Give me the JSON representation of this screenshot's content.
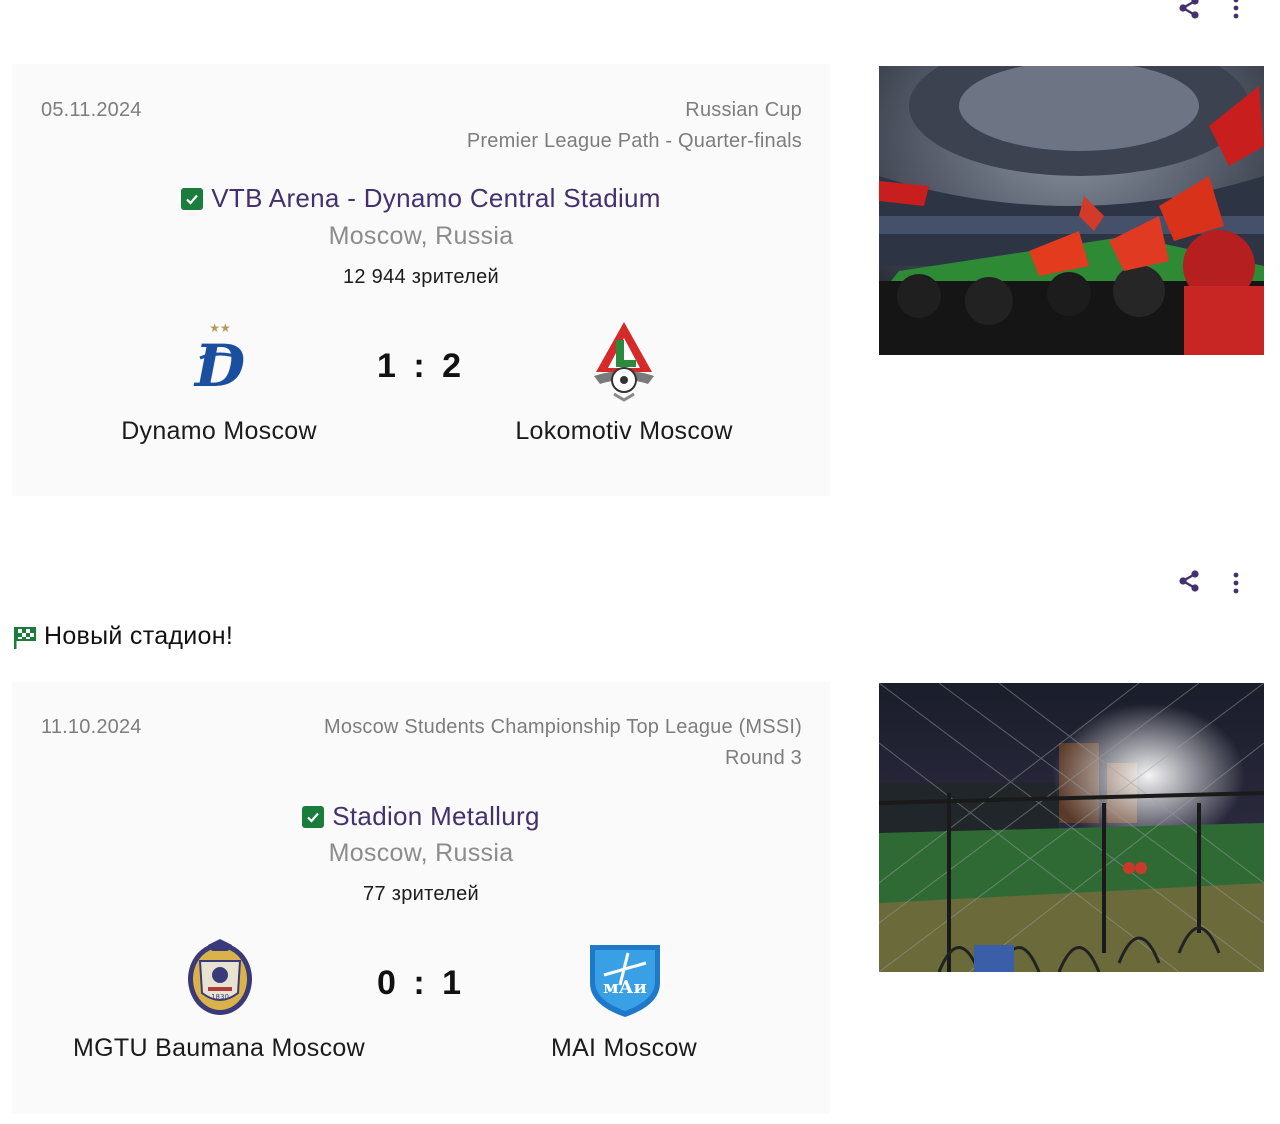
{
  "colors": {
    "accent": "#43306e",
    "check_green": "#1b7d3c",
    "muted": "#7d7d7d"
  },
  "matches": [
    {
      "date": "05.11.2024",
      "competition": "Russian Cup",
      "stage": "Premier League Path - Quarter-finals",
      "venue": "VTB Arena - Dynamo Central Stadium",
      "venue_verified": true,
      "city": "Moscow, Russia",
      "attendance": "12 944 зрителей",
      "score": "1 : 2",
      "home": {
        "name": "Dynamo Moscow",
        "logo": "dynamo-logo"
      },
      "away": {
        "name": "Lokomotiv Moscow",
        "logo": "lokomotiv-logo"
      },
      "photo": "stadium-crowd-photo"
    },
    {
      "banner": "Новый стадион!",
      "banner_icon": "checkered-flag-icon",
      "date": "11.10.2024",
      "competition": "Moscow Students Championship Top League (MSSI)",
      "stage": "Round 3",
      "venue": "Stadion Metallurg",
      "venue_verified": true,
      "city": "Moscow, Russia",
      "attendance": "77 зрителей",
      "score": "0 : 1",
      "home": {
        "name": "MGTU Baumana Moscow",
        "logo": "mgtu-logo",
        "logo_text": "1830"
      },
      "away": {
        "name": "MAI Moscow",
        "logo": "mai-logo",
        "logo_text": "мАи"
      },
      "photo": "night-pitch-photo"
    }
  ],
  "icons": {
    "share": "share-icon",
    "more": "more-vertical-icon",
    "check": "check-icon"
  }
}
